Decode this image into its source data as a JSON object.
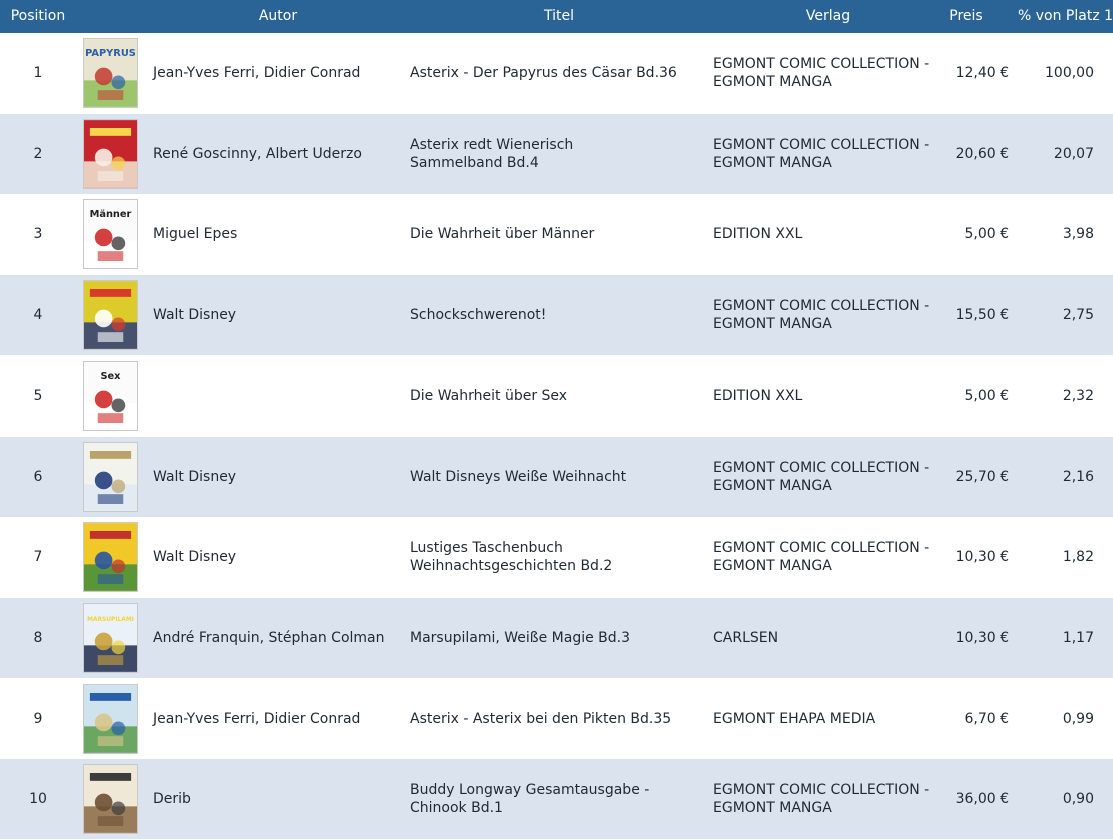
{
  "headers": {
    "position": "Position",
    "autor": "Autor",
    "titel": "Titel",
    "verlag": "Verlag",
    "preis": "Preis",
    "pct": "% von Platz 1"
  },
  "colors": {
    "header_bg": "#2a6496",
    "row_alt": "#dbe3ee",
    "row_plain": "#ffffff"
  },
  "rows": [
    {
      "position": "1",
      "cover_icon": "asterix-papyrus-cover-icon",
      "cover_title": "PAPYRUS",
      "autor": "Jean-Yves Ferri, Didier Conrad",
      "titel": [
        "Asterix - Der Papyrus des Cäsar Bd.36"
      ],
      "verlag": [
        "EGMONT COMIC COLLECTION -",
        "EGMONT MANGA"
      ],
      "preis": "12,40 €",
      "pct": "100,00"
    },
    {
      "position": "2",
      "cover_icon": "asterix-wienerisch-cover-icon",
      "cover_title": "",
      "autor": "René Goscinny, Albert Uderzo",
      "titel": [
        "Asterix redt Wienerisch",
        "Sammelband Bd.4"
      ],
      "verlag": [
        "EGMONT COMIC COLLECTION -",
        "EGMONT MANGA"
      ],
      "preis": "20,60 €",
      "pct": "20,07"
    },
    {
      "position": "3",
      "cover_icon": "maenner-cover-icon",
      "cover_title": "Männer",
      "autor": "Miguel Epes",
      "titel": [
        "Die Wahrheit über Männer"
      ],
      "verlag": [
        "EDITION XXL"
      ],
      "preis": "5,00 €",
      "pct": "3,98"
    },
    {
      "position": "4",
      "cover_icon": "donald-duck-cover-icon",
      "cover_title": "",
      "autor": "Walt Disney",
      "titel": [
        "Schockschwerenot!"
      ],
      "verlag": [
        "EGMONT COMIC COLLECTION -",
        "EGMONT MANGA"
      ],
      "preis": "15,50 €",
      "pct": "2,75"
    },
    {
      "position": "5",
      "cover_icon": "sex-cover-icon",
      "cover_title": "Sex",
      "autor": "",
      "titel": [
        "Die Wahrheit über Sex"
      ],
      "verlag": [
        "EDITION XXL"
      ],
      "preis": "5,00 €",
      "pct": "2,32"
    },
    {
      "position": "6",
      "cover_icon": "weisse-weihnacht-cover-icon",
      "cover_title": "",
      "autor": "Walt Disney",
      "titel": [
        "Walt Disneys Weiße Weihnacht"
      ],
      "verlag": [
        "EGMONT COMIC COLLECTION -",
        "EGMONT MANGA"
      ],
      "preis": "25,70 €",
      "pct": "2,16"
    },
    {
      "position": "7",
      "cover_icon": "lustiges-taschenbuch-cover-icon",
      "cover_title": "",
      "autor": "Walt Disney",
      "titel": [
        "Lustiges Taschenbuch",
        "Weihnachtsgeschichten Bd.2"
      ],
      "verlag": [
        "EGMONT COMIC COLLECTION -",
        "EGMONT MANGA"
      ],
      "preis": "10,30 €",
      "pct": "1,82"
    },
    {
      "position": "8",
      "cover_icon": "marsupilami-cover-icon",
      "cover_title": "MARSUPILAMI",
      "autor": "André Franquin, Stéphan Colman",
      "titel": [
        "Marsupilami, Weiße Magie Bd.3"
      ],
      "verlag": [
        "CARLSEN"
      ],
      "preis": "10,30 €",
      "pct": "1,17"
    },
    {
      "position": "9",
      "cover_icon": "asterix-pikten-cover-icon",
      "cover_title": "",
      "autor": "Jean-Yves Ferri, Didier Conrad",
      "titel": [
        "Asterix - Asterix bei den Pikten Bd.35"
      ],
      "verlag": [
        "EGMONT EHAPA MEDIA"
      ],
      "preis": "6,70 €",
      "pct": "0,99"
    },
    {
      "position": "10",
      "cover_icon": "buddy-longway-cover-icon",
      "cover_title": "",
      "autor": "Derib",
      "titel": [
        "Buddy Longway Gesamtausgabe -",
        "Chinook Bd.1"
      ],
      "verlag": [
        "EGMONT COMIC COLLECTION -",
        "EGMONT MANGA"
      ],
      "preis": "36,00 €",
      "pct": "0,90"
    }
  ]
}
